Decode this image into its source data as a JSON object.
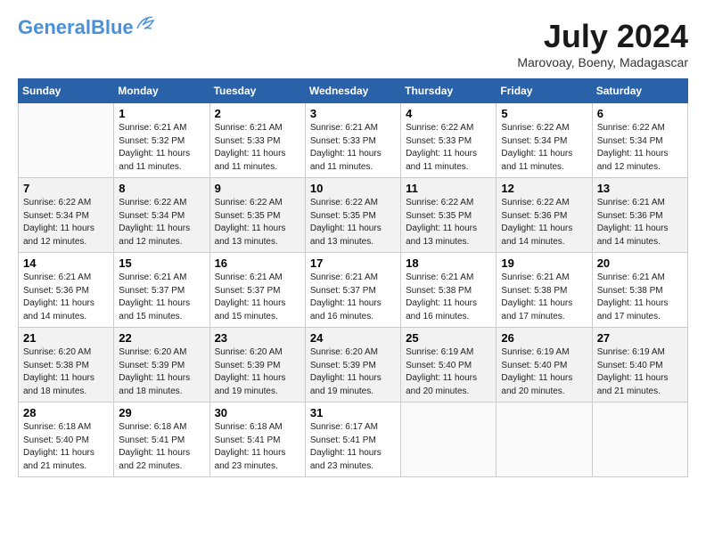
{
  "header": {
    "logo_line1": "General",
    "logo_line2": "Blue",
    "month_year": "July 2024",
    "location": "Marovoay, Boeny, Madagascar"
  },
  "weekdays": [
    "Sunday",
    "Monday",
    "Tuesday",
    "Wednesday",
    "Thursday",
    "Friday",
    "Saturday"
  ],
  "weeks": [
    [
      {
        "day": "",
        "info": ""
      },
      {
        "day": "1",
        "info": "Sunrise: 6:21 AM\nSunset: 5:32 PM\nDaylight: 11 hours\nand 11 minutes."
      },
      {
        "day": "2",
        "info": "Sunrise: 6:21 AM\nSunset: 5:33 PM\nDaylight: 11 hours\nand 11 minutes."
      },
      {
        "day": "3",
        "info": "Sunrise: 6:21 AM\nSunset: 5:33 PM\nDaylight: 11 hours\nand 11 minutes."
      },
      {
        "day": "4",
        "info": "Sunrise: 6:22 AM\nSunset: 5:33 PM\nDaylight: 11 hours\nand 11 minutes."
      },
      {
        "day": "5",
        "info": "Sunrise: 6:22 AM\nSunset: 5:34 PM\nDaylight: 11 hours\nand 11 minutes."
      },
      {
        "day": "6",
        "info": "Sunrise: 6:22 AM\nSunset: 5:34 PM\nDaylight: 11 hours\nand 12 minutes."
      }
    ],
    [
      {
        "day": "7",
        "info": "Sunrise: 6:22 AM\nSunset: 5:34 PM\nDaylight: 11 hours\nand 12 minutes."
      },
      {
        "day": "8",
        "info": "Sunrise: 6:22 AM\nSunset: 5:34 PM\nDaylight: 11 hours\nand 12 minutes."
      },
      {
        "day": "9",
        "info": "Sunrise: 6:22 AM\nSunset: 5:35 PM\nDaylight: 11 hours\nand 13 minutes."
      },
      {
        "day": "10",
        "info": "Sunrise: 6:22 AM\nSunset: 5:35 PM\nDaylight: 11 hours\nand 13 minutes."
      },
      {
        "day": "11",
        "info": "Sunrise: 6:22 AM\nSunset: 5:35 PM\nDaylight: 11 hours\nand 13 minutes."
      },
      {
        "day": "12",
        "info": "Sunrise: 6:22 AM\nSunset: 5:36 PM\nDaylight: 11 hours\nand 14 minutes."
      },
      {
        "day": "13",
        "info": "Sunrise: 6:21 AM\nSunset: 5:36 PM\nDaylight: 11 hours\nand 14 minutes."
      }
    ],
    [
      {
        "day": "14",
        "info": "Sunrise: 6:21 AM\nSunset: 5:36 PM\nDaylight: 11 hours\nand 14 minutes."
      },
      {
        "day": "15",
        "info": "Sunrise: 6:21 AM\nSunset: 5:37 PM\nDaylight: 11 hours\nand 15 minutes."
      },
      {
        "day": "16",
        "info": "Sunrise: 6:21 AM\nSunset: 5:37 PM\nDaylight: 11 hours\nand 15 minutes."
      },
      {
        "day": "17",
        "info": "Sunrise: 6:21 AM\nSunset: 5:37 PM\nDaylight: 11 hours\nand 16 minutes."
      },
      {
        "day": "18",
        "info": "Sunrise: 6:21 AM\nSunset: 5:38 PM\nDaylight: 11 hours\nand 16 minutes."
      },
      {
        "day": "19",
        "info": "Sunrise: 6:21 AM\nSunset: 5:38 PM\nDaylight: 11 hours\nand 17 minutes."
      },
      {
        "day": "20",
        "info": "Sunrise: 6:21 AM\nSunset: 5:38 PM\nDaylight: 11 hours\nand 17 minutes."
      }
    ],
    [
      {
        "day": "21",
        "info": "Sunrise: 6:20 AM\nSunset: 5:38 PM\nDaylight: 11 hours\nand 18 minutes."
      },
      {
        "day": "22",
        "info": "Sunrise: 6:20 AM\nSunset: 5:39 PM\nDaylight: 11 hours\nand 18 minutes."
      },
      {
        "day": "23",
        "info": "Sunrise: 6:20 AM\nSunset: 5:39 PM\nDaylight: 11 hours\nand 19 minutes."
      },
      {
        "day": "24",
        "info": "Sunrise: 6:20 AM\nSunset: 5:39 PM\nDaylight: 11 hours\nand 19 minutes."
      },
      {
        "day": "25",
        "info": "Sunrise: 6:19 AM\nSunset: 5:40 PM\nDaylight: 11 hours\nand 20 minutes."
      },
      {
        "day": "26",
        "info": "Sunrise: 6:19 AM\nSunset: 5:40 PM\nDaylight: 11 hours\nand 20 minutes."
      },
      {
        "day": "27",
        "info": "Sunrise: 6:19 AM\nSunset: 5:40 PM\nDaylight: 11 hours\nand 21 minutes."
      }
    ],
    [
      {
        "day": "28",
        "info": "Sunrise: 6:18 AM\nSunset: 5:40 PM\nDaylight: 11 hours\nand 21 minutes."
      },
      {
        "day": "29",
        "info": "Sunrise: 6:18 AM\nSunset: 5:41 PM\nDaylight: 11 hours\nand 22 minutes."
      },
      {
        "day": "30",
        "info": "Sunrise: 6:18 AM\nSunset: 5:41 PM\nDaylight: 11 hours\nand 23 minutes."
      },
      {
        "day": "31",
        "info": "Sunrise: 6:17 AM\nSunset: 5:41 PM\nDaylight: 11 hours\nand 23 minutes."
      },
      {
        "day": "",
        "info": ""
      },
      {
        "day": "",
        "info": ""
      },
      {
        "day": "",
        "info": ""
      }
    ]
  ]
}
